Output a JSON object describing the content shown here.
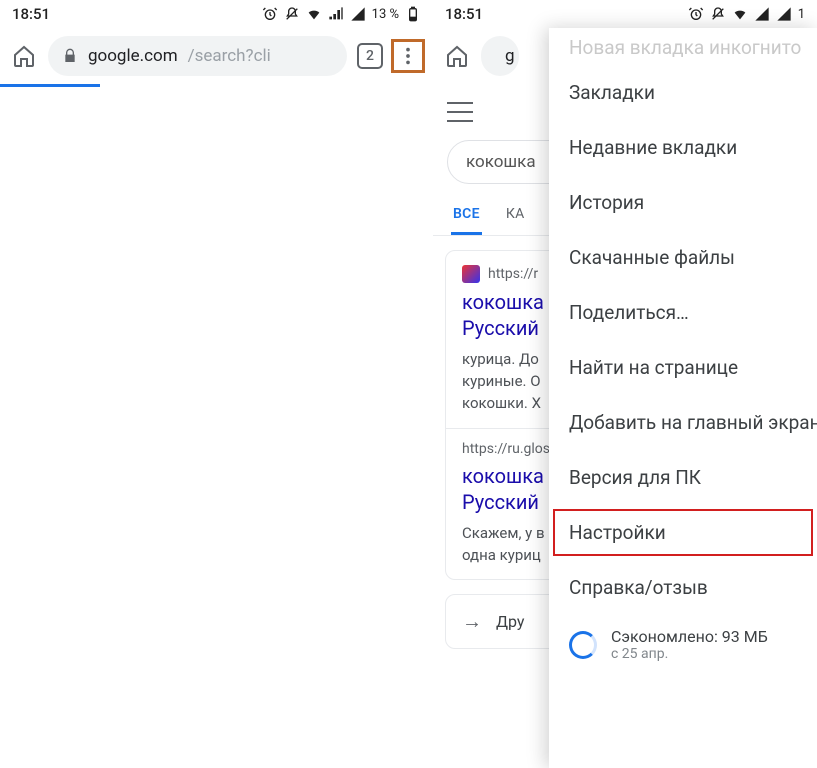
{
  "status": {
    "time": "18:51",
    "battery_pct": "13 %",
    "battery_pct2": "1"
  },
  "left": {
    "url_host": "google.com",
    "url_query": "/search?cli",
    "tab_count": "2"
  },
  "right": {
    "url_short": "g",
    "search_value": "кокошка",
    "tab_all": "ВСЕ",
    "tab_images": "КА",
    "result1": {
      "src_url": "https://r",
      "title_l1": "кокошка",
      "title_l2": "Русский",
      "snippet_l1": "курица. До",
      "snippet_l2": "куриные. О",
      "snippet_l3": "кокошки. Х",
      "url2": "https://ru.glos",
      "title2_l1": "кокошка",
      "title2_l2": "Русский",
      "snippet2_l1": "Скажем, у в",
      "snippet2_l2": "одна куриц"
    },
    "others_label": "Дру"
  },
  "menu": {
    "ghost_header": "Новая вкладка инкогнито",
    "items": [
      "Закладки",
      "Недавние вкладки",
      "История",
      "Скачанные файлы",
      "Поделиться…",
      "Найти на странице",
      "Добавить на главный экран",
      "Версия для ПК",
      "Настройки",
      "Справка/отзыв"
    ],
    "highlight_index": 8,
    "saver_line1": "Сэкономлено: 93 МБ",
    "saver_line2": "с 25 апр."
  }
}
